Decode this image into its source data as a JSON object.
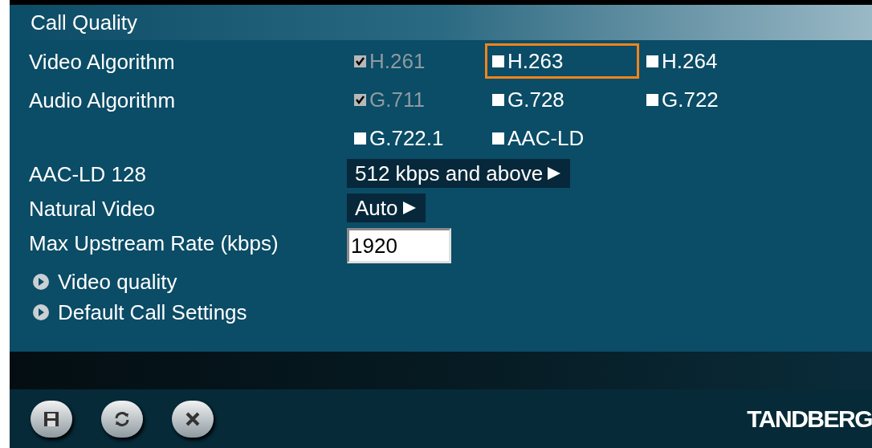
{
  "title": "Call Quality",
  "settings": [
    {
      "label": "Video Algorithm",
      "kind": "checkboxes",
      "options": [
        {
          "label": "H.261",
          "checked": true,
          "disabled": true,
          "focused": false
        },
        {
          "label": "H.263",
          "checked": false,
          "disabled": false,
          "focused": true
        },
        {
          "label": "H.264",
          "checked": false,
          "disabled": false,
          "focused": false
        }
      ]
    },
    {
      "label": "Audio Algorithm",
      "kind": "checkboxes",
      "options": [
        {
          "label": "G.711",
          "checked": true,
          "disabled": true,
          "focused": false
        },
        {
          "label": "G.728",
          "checked": false,
          "disabled": false,
          "focused": false
        },
        {
          "label": "G.722",
          "checked": false,
          "disabled": false,
          "focused": false
        },
        {
          "label": "G.722.1",
          "checked": false,
          "disabled": false,
          "focused": false
        },
        {
          "label": "AAC-LD",
          "checked": false,
          "disabled": false,
          "focused": false
        }
      ]
    },
    {
      "label": "AAC-LD 128",
      "kind": "select",
      "value": "512 kbps and above"
    },
    {
      "label": "Natural Video",
      "kind": "select",
      "value": "Auto"
    },
    {
      "label": "Max Upstream Rate (kbps)",
      "kind": "input",
      "value": "1920"
    }
  ],
  "links": [
    "Video quality",
    "Default Call Settings"
  ],
  "logo": "TANDBERG"
}
